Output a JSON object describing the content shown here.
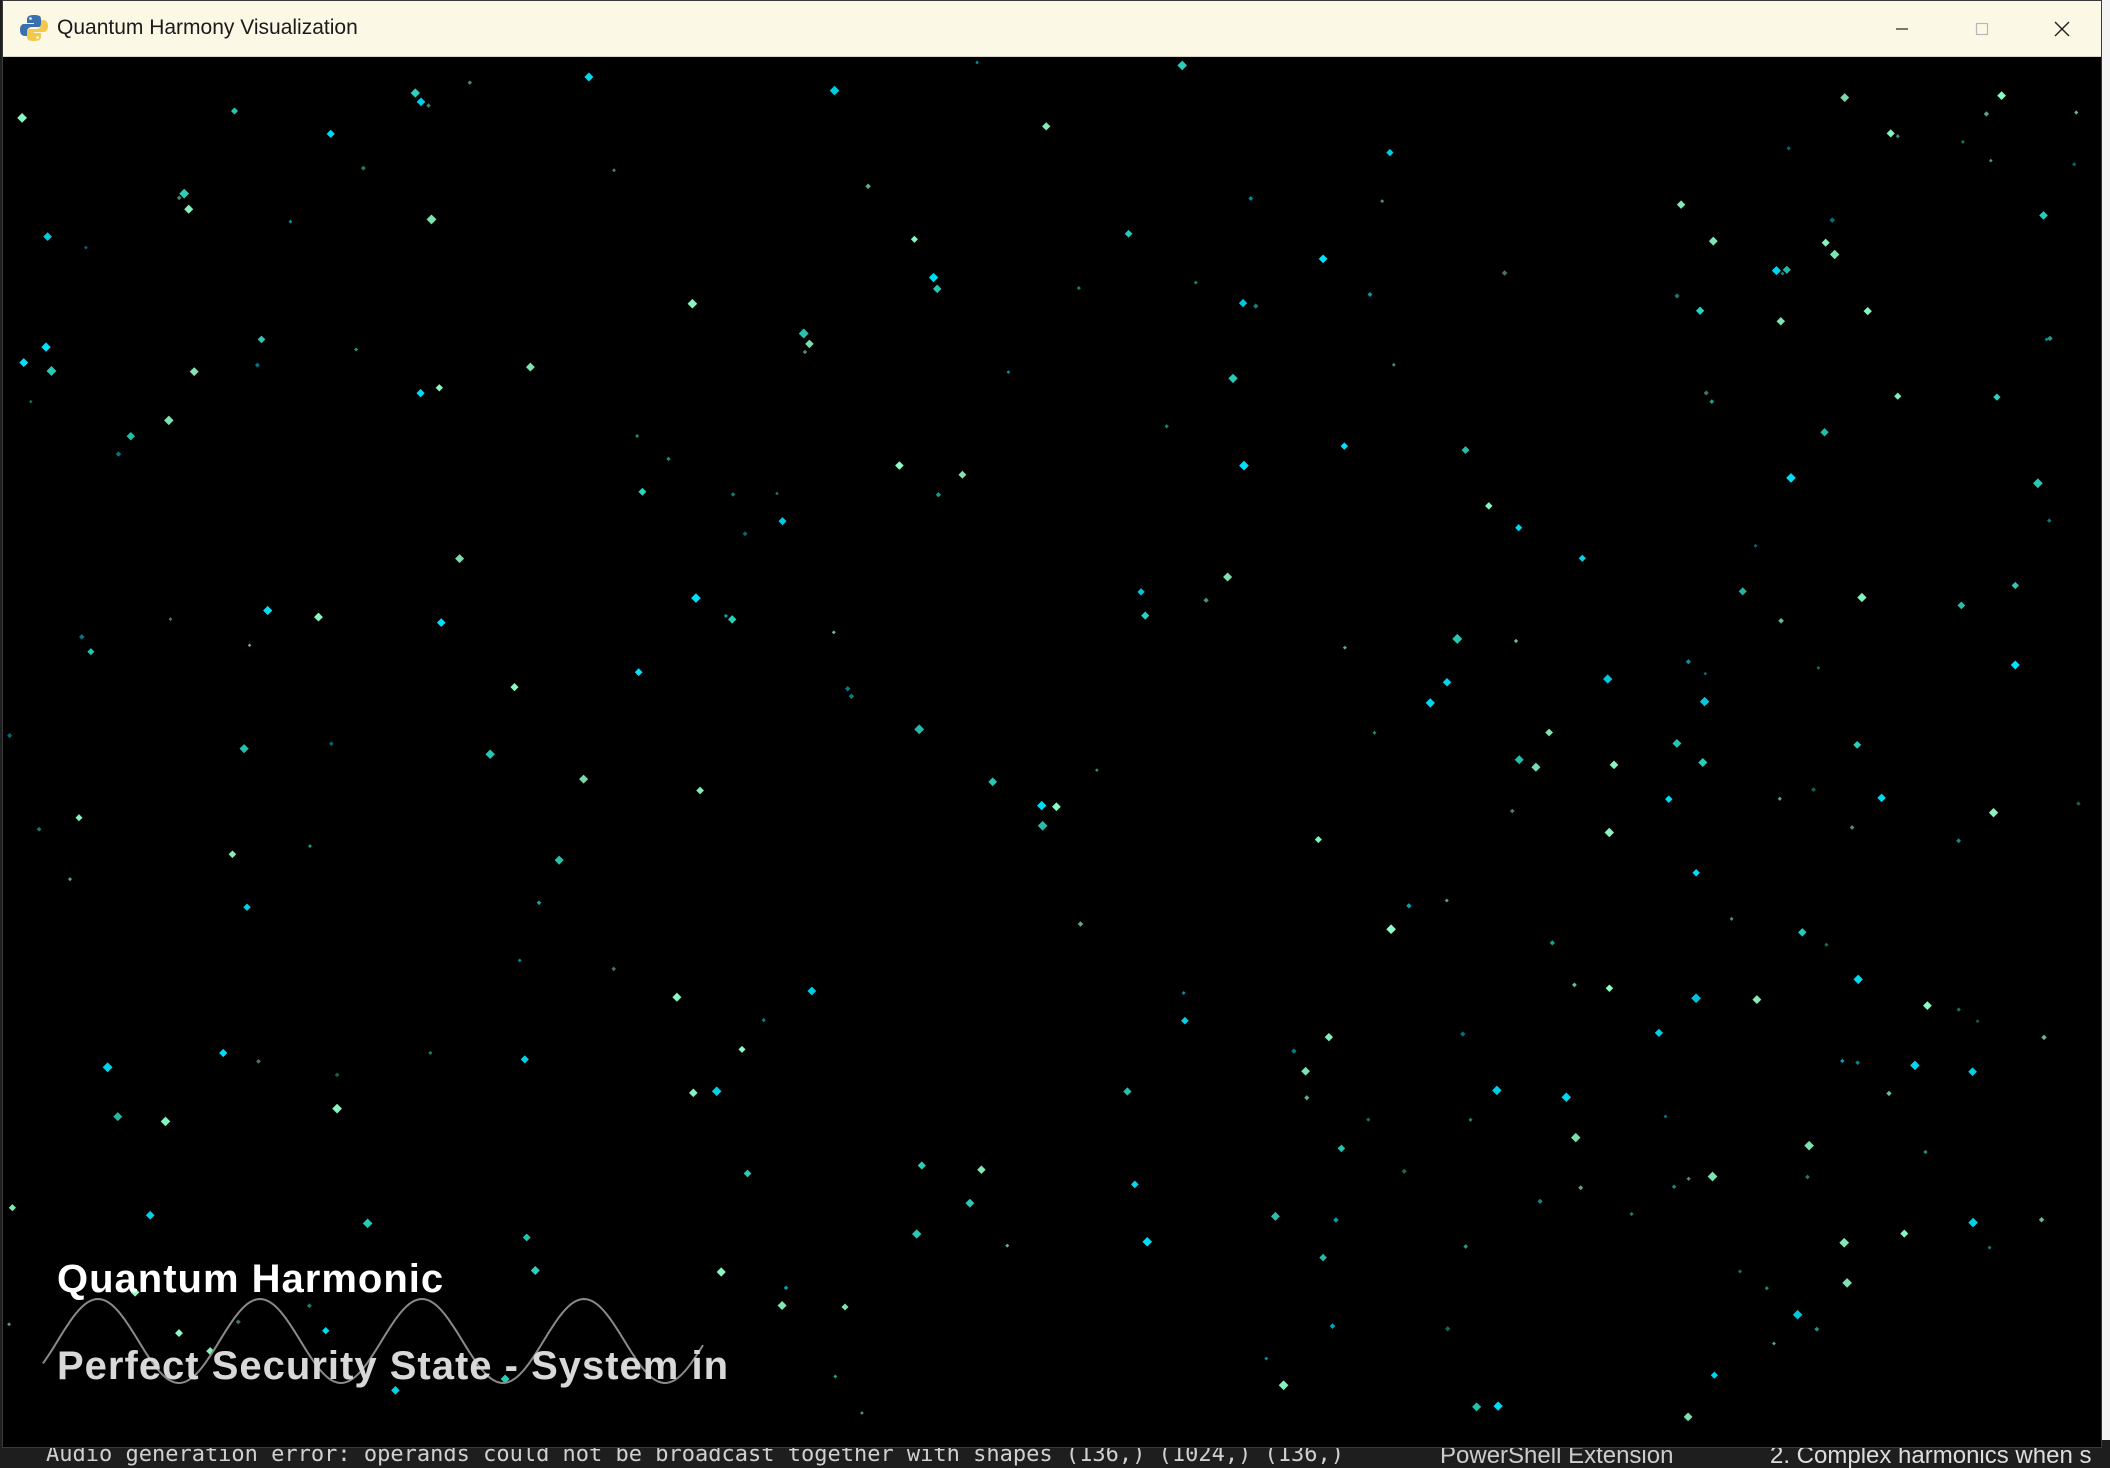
{
  "window": {
    "title": "Quantum Harmony Visualization",
    "icon": "python-icon"
  },
  "hud": {
    "title": "Quantum Harmonic",
    "status": "Perfect Security State - System in"
  },
  "background": {
    "terminal_line": "Audio generation error: operands could not be broadcast together with shapes (136,) (1024,) (136,)",
    "powershell_label": "PowerShell Extension",
    "right_text": "2.  Complex harmonics when s"
  },
  "colors": {
    "canvas_background": "#000000",
    "particle_cyan": "#00e5ff",
    "particle_teal": "#2ad6c0",
    "particle_mint": "#8effc8",
    "wave_stroke": "#8a8a8a",
    "titlebar": "#fbf8e6"
  }
}
